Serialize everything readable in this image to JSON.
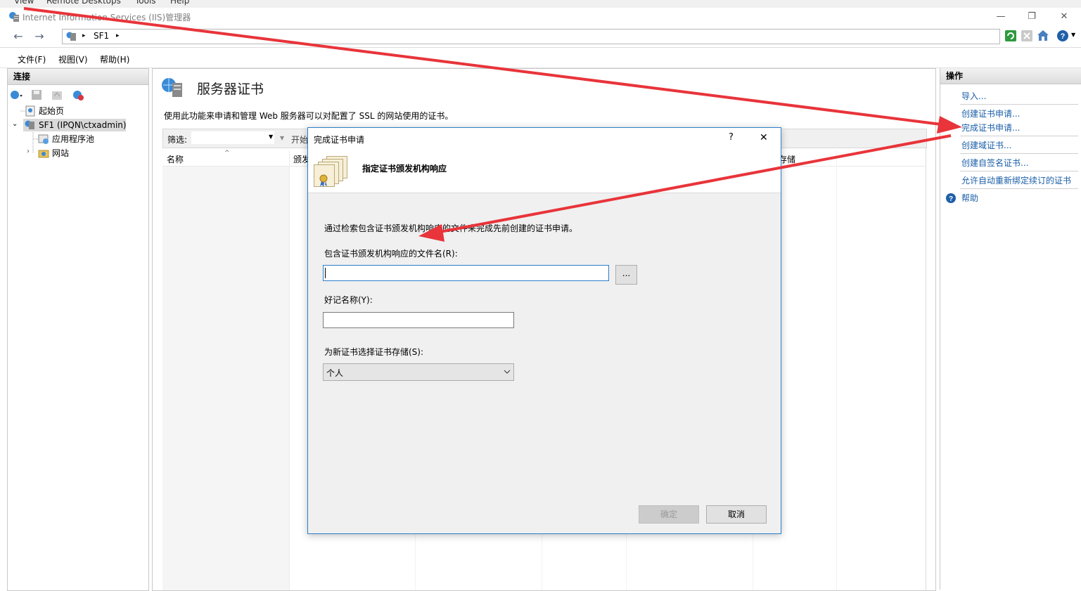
{
  "host_menu": {
    "items": [
      "View",
      "Remote Desktops",
      "Tools",
      "Help"
    ]
  },
  "window": {
    "title": "Internet Information Services (IIS)管理器",
    "controls": {
      "minimize": "—",
      "restore": "❐",
      "close": "✕"
    }
  },
  "address": {
    "node": "SF1",
    "separator": "▸"
  },
  "menubar": {
    "items": [
      "文件(F)",
      "视图(V)",
      "帮助(H)"
    ]
  },
  "connections": {
    "heading": "连接",
    "tree": [
      {
        "label": "起始页"
      },
      {
        "label": "SF1 (IPQN\\ctxadmin)"
      },
      {
        "label": "应用程序池"
      },
      {
        "label": "网站"
      }
    ]
  },
  "feature": {
    "title": "服务器证书",
    "description": "使用此功能来申请和管理 Web 服务器可以对配置了 SSL 的网站使用的证书。",
    "filter_label": "筛选:",
    "start_label": "开始",
    "columns": [
      "名称",
      "颁发",
      "存储"
    ]
  },
  "actions": {
    "heading": "操作",
    "items": [
      "导入...",
      "创建证书申请...",
      "完成证书申请...",
      "创建域证书...",
      "创建自签名证书...",
      "允许自动重新绑定续订的证书",
      "帮助"
    ]
  },
  "dialog": {
    "title": "完成证书申请",
    "help_glyph": "?",
    "close_glyph": "✕",
    "header": "指定证书颁发机构响应",
    "intro": "通过检索包含证书颁发机构响应的文件来完成先前创建的证书申请。",
    "file_label": "包含证书颁发机构响应的文件名(R):",
    "file_value": "",
    "browse_label": "...",
    "friendly_label": "好记名称(Y):",
    "friendly_value": "",
    "store_label": "为新证书选择证书存储(S):",
    "store_selected": "个人",
    "ok_label": "确定",
    "cancel_label": "取消"
  },
  "colors": {
    "accent": "#2a7fc9",
    "link": "#1a5ea8",
    "arrow": "#e8343a"
  }
}
